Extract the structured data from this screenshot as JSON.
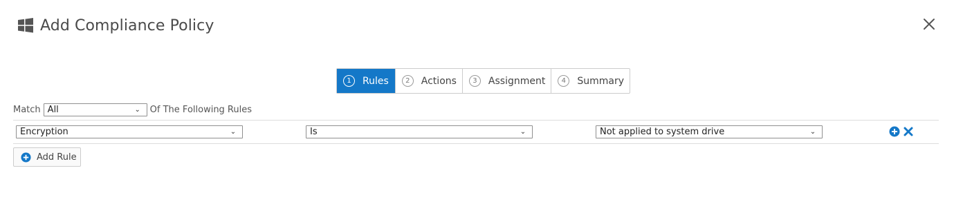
{
  "dialog": {
    "title": "Add Compliance Policy",
    "icon": "windows-logo-icon",
    "close_icon": "close-icon"
  },
  "wizard": {
    "active_step": 1,
    "steps": [
      {
        "number": "1",
        "label": "Rules"
      },
      {
        "number": "2",
        "label": "Actions"
      },
      {
        "number": "3",
        "label": "Assignment"
      },
      {
        "number": "4",
        "label": "Summary"
      }
    ]
  },
  "match": {
    "prefix": "Match",
    "selected": "All",
    "suffix": "Of The Following Rules"
  },
  "rules": [
    {
      "field": "Encryption",
      "operator": "Is",
      "value": "Not applied to system drive",
      "add_icon": "plus-circle-icon",
      "remove_icon": "x-icon"
    }
  ],
  "add_rule_button": {
    "label": "Add Rule",
    "icon": "plus-circle-icon"
  },
  "colors": {
    "accent": "#1478c8",
    "border": "#cccccc",
    "text": "#333333"
  }
}
